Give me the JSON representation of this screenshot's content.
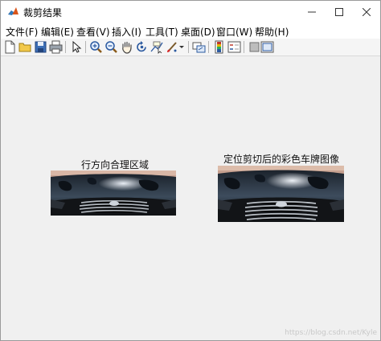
{
  "window": {
    "title": "裁剪结果"
  },
  "menu": {
    "items": [
      {
        "label": "文件(F)"
      },
      {
        "label": "编辑(E)"
      },
      {
        "label": "查看(V)"
      },
      {
        "label": "插入(I)"
      },
      {
        "label": "工具(T)"
      },
      {
        "label": "桌面(D)"
      },
      {
        "label": "窗口(W)"
      },
      {
        "label": "帮助(H)"
      }
    ]
  },
  "toolbar": {
    "icons": [
      "new-figure-icon",
      "open-file-icon",
      "save-icon",
      "print-icon",
      "pointer-icon",
      "zoom-in-icon",
      "zoom-out-icon",
      "pan-hand-icon",
      "rotate-3d-icon",
      "data-cursor-icon",
      "brush-icon",
      "brush-dropdown-icon",
      "link-plot-icon",
      "colorbar-icon",
      "legend-icon",
      "hide-plot-tools-icon",
      "show-plot-tools-icon"
    ]
  },
  "figure": {
    "left_title": "行方向合理区域",
    "right_title": "定位剪切后的彩色车牌图像",
    "watermark": "https://blog.csdn.net/Kyle"
  }
}
